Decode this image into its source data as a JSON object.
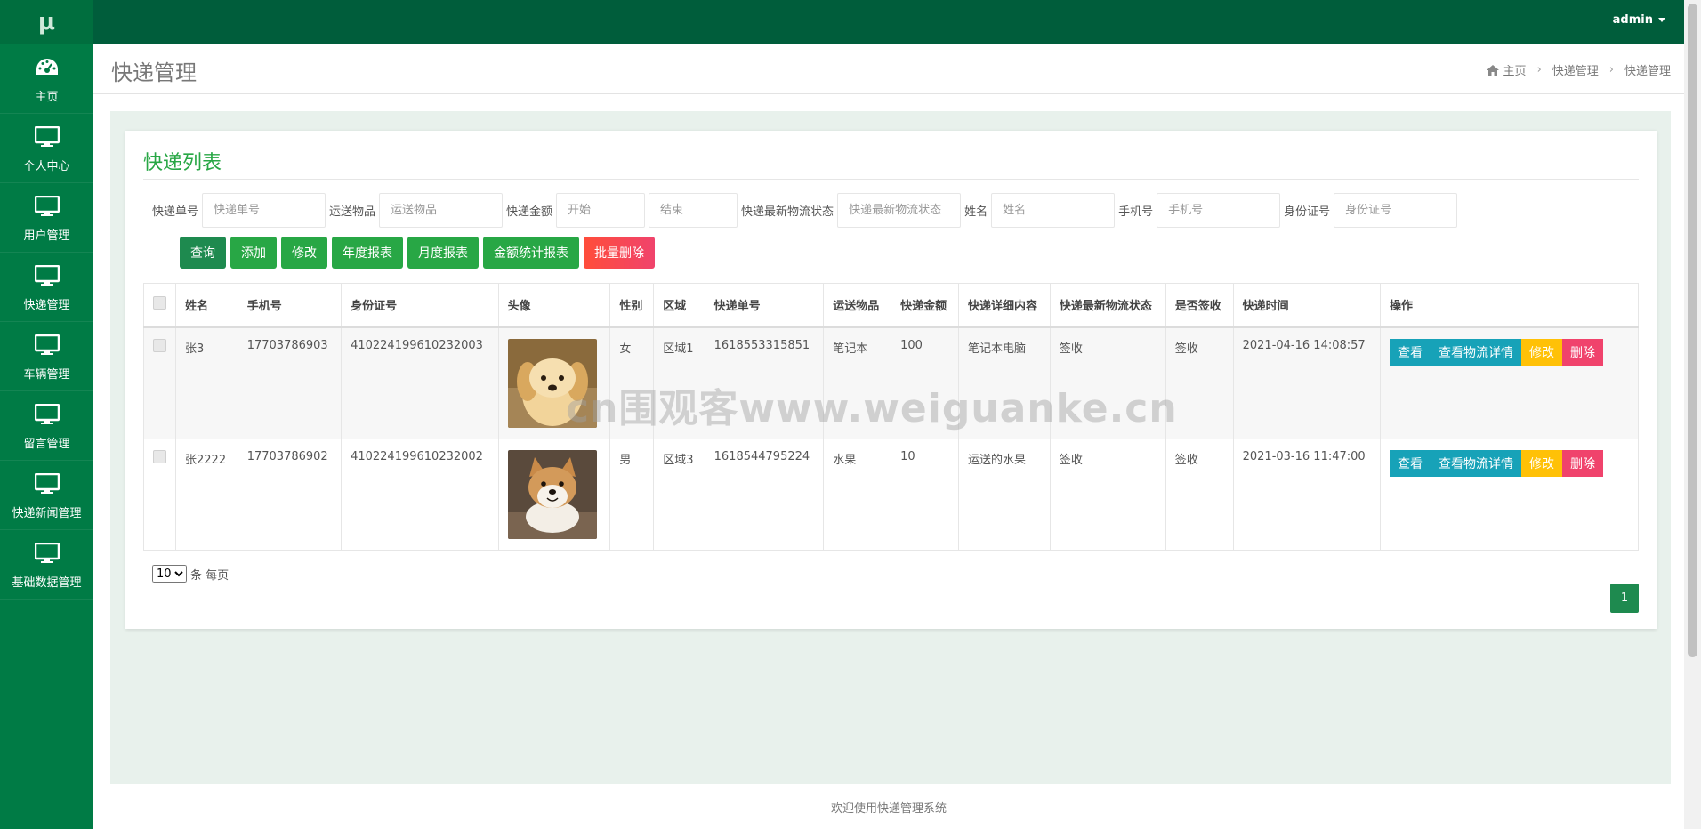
{
  "app": {
    "logo": "μ"
  },
  "sidebar": {
    "items": [
      {
        "label": "主页",
        "icon": "dashboard-icon"
      },
      {
        "label": "个人中心",
        "icon": "monitor-icon"
      },
      {
        "label": "用户管理",
        "icon": "monitor-icon"
      },
      {
        "label": "快递管理",
        "icon": "monitor-icon"
      },
      {
        "label": "车辆管理",
        "icon": "monitor-icon"
      },
      {
        "label": "留言管理",
        "icon": "monitor-icon"
      },
      {
        "label": "快递新闻管理",
        "icon": "monitor-icon"
      },
      {
        "label": "基础数据管理",
        "icon": "monitor-icon"
      }
    ]
  },
  "topbar": {
    "user": "admin"
  },
  "header": {
    "title": "快递管理",
    "breadcrumb": [
      "主页",
      "快递管理",
      "快递管理"
    ]
  },
  "card": {
    "title": "快递列表"
  },
  "filters": [
    {
      "label": "快递单号",
      "placeholder": "快递单号"
    },
    {
      "label": "运送物品",
      "placeholder": "运送物品"
    },
    {
      "label": "快递金额",
      "placeholder": "开始",
      "placeholder2": "结束"
    },
    {
      "label": "快递最新物流状态",
      "placeholder": "快递最新物流状态"
    },
    {
      "label": "姓名",
      "placeholder": "姓名"
    },
    {
      "label": "手机号",
      "placeholder": "手机号"
    },
    {
      "label": "身份证号",
      "placeholder": "身份证号"
    }
  ],
  "buttons": {
    "query": "查询",
    "add": "添加",
    "edit": "修改",
    "yearly": "年度报表",
    "monthly": "月度报表",
    "amount": "金额统计报表",
    "batch_delete": "批量删除"
  },
  "table": {
    "headers": [
      "姓名",
      "手机号",
      "身份证号",
      "头像",
      "性别",
      "区域",
      "快递单号",
      "运送物品",
      "快递金额",
      "快递详细内容",
      "快递最新物流状态",
      "是否签收",
      "快递时间",
      "操作"
    ],
    "rows": [
      {
        "name": "张3",
        "phone": "17703786903",
        "id_card": "410224199610232003",
        "avatar": "puppy-photo",
        "gender": "女",
        "region": "区域1",
        "tracking": "1618553315851",
        "item": "笔记本",
        "amount": "100",
        "detail": "笔记本电脑",
        "status": "签收",
        "signed": "签收",
        "time": "2021-04-16 14:08:57"
      },
      {
        "name": "张2222",
        "phone": "17703786902",
        "id_card": "410224199610232002",
        "avatar": "shiba-photo",
        "gender": "男",
        "region": "区域3",
        "tracking": "1618544795224",
        "item": "水果",
        "amount": "10",
        "detail": "运送的水果",
        "status": "签收",
        "signed": "签收",
        "time": "2021-03-16 11:47:00"
      }
    ],
    "row_actions": {
      "view": "查看",
      "logistics": "查看物流详情",
      "edit": "修改",
      "delete": "删除"
    }
  },
  "pagination": {
    "page_size": "10",
    "page_size_suffix": "条 每页",
    "current": "1"
  },
  "watermark": "cn围观客www.weiguanke.cn",
  "footer": "欢迎使用快递管理系统"
}
